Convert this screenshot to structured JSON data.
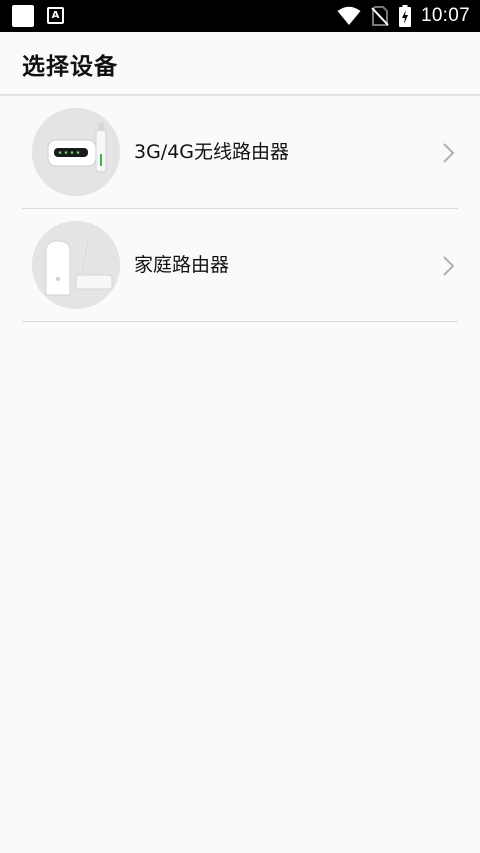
{
  "status_bar": {
    "time": "10:07",
    "notification_icon_letter": "A"
  },
  "header": {
    "title": "选择设备"
  },
  "devices": [
    {
      "label": "3G/4G无线路由器",
      "icon": "mobile-wifi-router-image"
    },
    {
      "label": "家庭路由器",
      "icon": "home-router-image"
    }
  ],
  "colors": {
    "status_bar_bg": "#000000",
    "page_bg": "#fafafa",
    "divider": "#dcdcdc",
    "chevron": "#b0b0b0"
  }
}
